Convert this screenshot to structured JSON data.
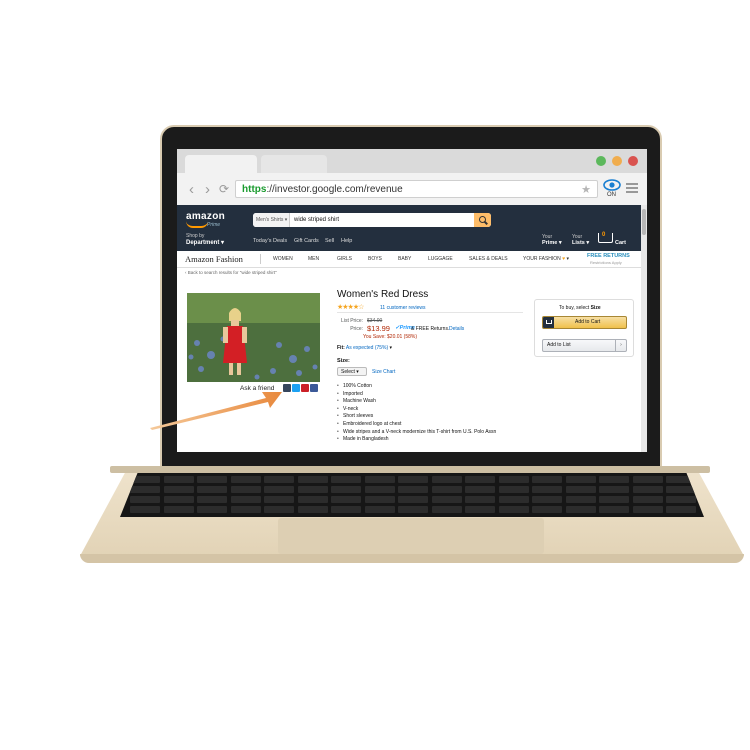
{
  "browser": {
    "url_scheme": "https",
    "url_rest": "://investor.google.com/revenue",
    "extension_label": "ON",
    "traffic_lights": [
      "#5cb85c",
      "#f0ad4e",
      "#d9534f"
    ]
  },
  "amazon": {
    "logo": "amazon",
    "logo_sub": "Prime",
    "search_category": "Men's Shirts",
    "search_query": "wide striped shirt",
    "shop_by": "Shop by",
    "department": "Department",
    "nav": [
      "Today's Deals",
      "Gift Cards",
      "Sell",
      "Help"
    ],
    "your_prime_small": "Your",
    "your_prime_big": "Prime",
    "your_lists_small": "Your",
    "your_lists_big": "Lists",
    "cart_count": "0",
    "cart_label": "Cart",
    "accent": "#ff9900",
    "header_bg": "#232f3e"
  },
  "fashion_nav": {
    "brand": "Amazon Fashion",
    "items": [
      "WOMEN",
      "MEN",
      "GIRLS",
      "BOYS",
      "BABY",
      "LUGGAGE",
      "SALES & DEALS",
      "YOUR FASHION"
    ],
    "free_returns": "FREE RETURNS",
    "free_returns_sub": "Restrictions Apply"
  },
  "breadcrumb": "‹ Back to search results for \"wide striped shirt\"",
  "product": {
    "title": "Women's Red Dress",
    "stars": "★★★★☆",
    "reviews": "11 customer reviews",
    "list_price_label": "List Price:",
    "list_price": "$34.00",
    "price_label": "Price:",
    "price": "$13.99",
    "prime": "✓Prime",
    "returns": "& FREE Returns.",
    "details": "Details",
    "you_save": "You Save: $20.01 (58%)",
    "fit_label": "Fit:",
    "fit_value": "As expected (75%)",
    "size_label": "Size:",
    "size_select": "Select",
    "size_chart": "Size Chart",
    "bullets": [
      "100% Cotton",
      "Imported",
      "Machine Wash",
      "V-neck",
      "Short sleeves",
      "Embroidered logo at chest",
      "Wide stripes and a V-neck modernize this T-shirt from U.S. Polo Assn",
      "Made in Bangladesh"
    ],
    "ask_friend": "Ask a friend",
    "share_icons": [
      "tumblr-icon",
      "twitter-icon",
      "pinterest-icon",
      "facebook-icon"
    ]
  },
  "buy_box": {
    "to_buy_prefix": "To buy, select",
    "to_buy_bold": "Size",
    "add_to_cart": "Add to Cart",
    "add_to_list": "Add to List",
    "add_to_list_dd": "›"
  }
}
